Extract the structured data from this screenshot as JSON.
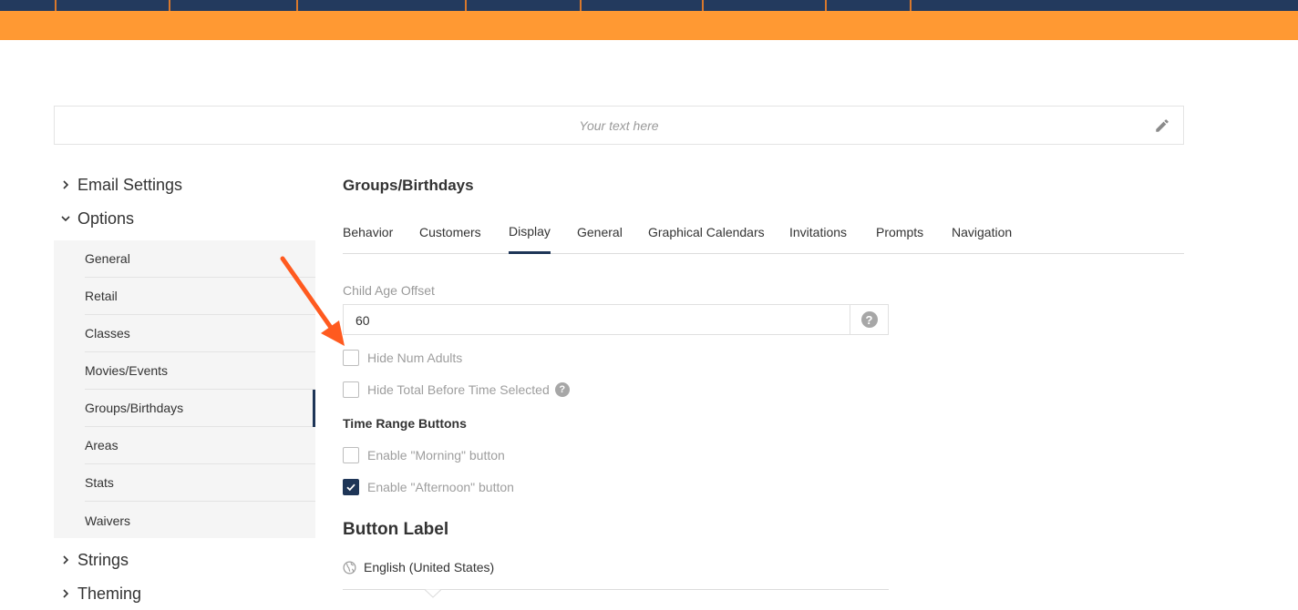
{
  "text_block": {
    "placeholder": "Your text here"
  },
  "sidebar": {
    "email_settings": "Email Settings",
    "options": "Options",
    "strings": "Strings",
    "theming": "Theming",
    "option_items": [
      {
        "label": "General"
      },
      {
        "label": "Retail"
      },
      {
        "label": "Classes"
      },
      {
        "label": "Movies/Events"
      },
      {
        "label": "Groups/Birthdays"
      },
      {
        "label": "Areas"
      },
      {
        "label": "Stats"
      },
      {
        "label": "Waivers"
      }
    ],
    "active_item": "Groups/Birthdays"
  },
  "main": {
    "title": "Groups/Birthdays",
    "tabs": [
      {
        "label": "Behavior"
      },
      {
        "label": "Customers"
      },
      {
        "label": "Display"
      },
      {
        "label": "General"
      },
      {
        "label": "Graphical Calendars"
      },
      {
        "label": "Invitations"
      },
      {
        "label": "Prompts"
      },
      {
        "label": "Navigation"
      }
    ],
    "active_tab": "Display",
    "child_age_offset": {
      "label": "Child Age Offset",
      "value": "60",
      "help": "?"
    },
    "hide_num_adults": {
      "label": "Hide Num Adults",
      "checked": false
    },
    "hide_total": {
      "label": "Hide Total Before Time Selected",
      "checked": false,
      "help": "?"
    },
    "time_range_heading": "Time Range Buttons",
    "enable_morning": {
      "label": "Enable \"Morning\" button",
      "checked": false
    },
    "enable_afternoon": {
      "label": "Enable \"Afternoon\" button",
      "checked": true
    },
    "button_label_heading": "Button Label",
    "language": "English (United States)"
  },
  "colors": {
    "nav": "#233a5e",
    "orange": "#ff9933",
    "accent": "#1e3557",
    "annotation_arrow": "#ff5a1f"
  }
}
